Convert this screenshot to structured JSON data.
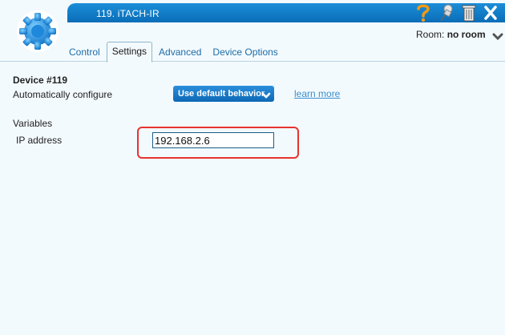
{
  "window": {
    "title": "119. iTACH-IR"
  },
  "room": {
    "label": "Room:",
    "value": "no room"
  },
  "tabs": [
    {
      "label": "Control"
    },
    {
      "label": "Settings"
    },
    {
      "label": "Advanced"
    },
    {
      "label": "Device Options"
    }
  ],
  "settings": {
    "device_title": "Device #119",
    "auto_config_label": "Automatically configure",
    "auto_config_value": "Use default behavior",
    "learn_more": "learn more",
    "variables_label": "Variables",
    "ip_label": "IP address",
    "ip_value": "192.168.2.6"
  },
  "icons": {
    "logo": "gear-icon",
    "help": "question-mark-icon",
    "pin": "pushpin-icon",
    "delete": "trash-icon",
    "close": "close-icon"
  },
  "colors": {
    "title_bar": "#0b6db8",
    "accent": "#1d6ca8",
    "highlight": "#e8332f"
  }
}
